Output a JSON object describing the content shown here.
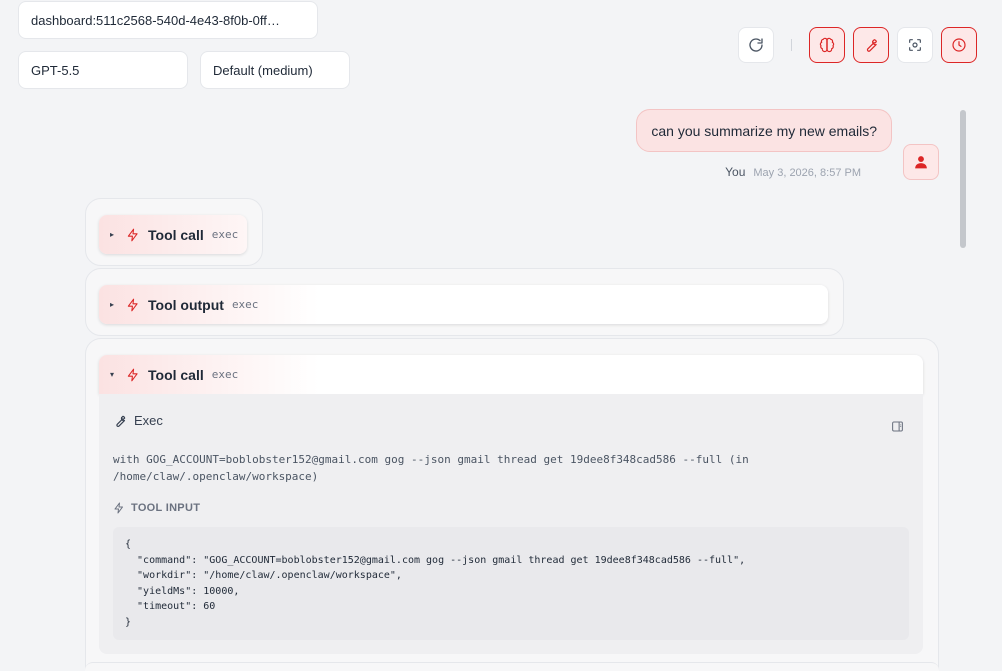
{
  "header": {
    "session": "dashboard:511c2568-540d-4e43-8f0b-0ff…",
    "model": "GPT-5.5",
    "thinking": "Default (medium)",
    "divider": "|"
  },
  "toolbar": {
    "buttons": [
      {
        "name": "refresh",
        "icon": "refresh-icon",
        "active": false
      },
      {
        "name": "thinking",
        "icon": "brain-icon",
        "active": true
      },
      {
        "name": "tools",
        "icon": "wrench-icon",
        "active": true
      },
      {
        "name": "focus",
        "icon": "focus-icon",
        "active": false
      },
      {
        "name": "cron",
        "icon": "clock-icon",
        "active": true
      }
    ]
  },
  "colors": {
    "accent": "#dc2626",
    "accent_soft": "#fde8e8",
    "background": "#f3f4f6"
  },
  "user_message": {
    "text": "can you summarize my new emails?",
    "sender": "You",
    "timestamp": "May 3, 2026, 8:57 PM"
  },
  "tool_groups": [
    {
      "caret": "▸",
      "title": "Tool call",
      "kind": "exec",
      "expanded": false
    },
    {
      "caret": "▸",
      "title": "Tool output",
      "kind": "exec",
      "expanded": false
    },
    {
      "caret": "▾",
      "title": "Tool call",
      "kind": "exec",
      "expanded": true
    }
  ],
  "expanded_tool": {
    "label": "Exec",
    "command_line_1": "with GOG_ACCOUNT=boblobster152@gmail.com gog --json gmail thread get 19dee8f348cad586 --full (in",
    "command_line_2": "/home/claw/.openclaw/workspace)",
    "input_label": "TOOL INPUT",
    "input_json": [
      "{",
      "  \"command\": \"GOG_ACCOUNT=boblobster152@gmail.com gog --json gmail thread get 19dee8f348cad586 --full\",",
      "  \"workdir\": \"/home/claw/.openclaw/workspace\",",
      "  \"yieldMs\": 10000,",
      "  \"timeout\": 60",
      "}"
    ]
  }
}
